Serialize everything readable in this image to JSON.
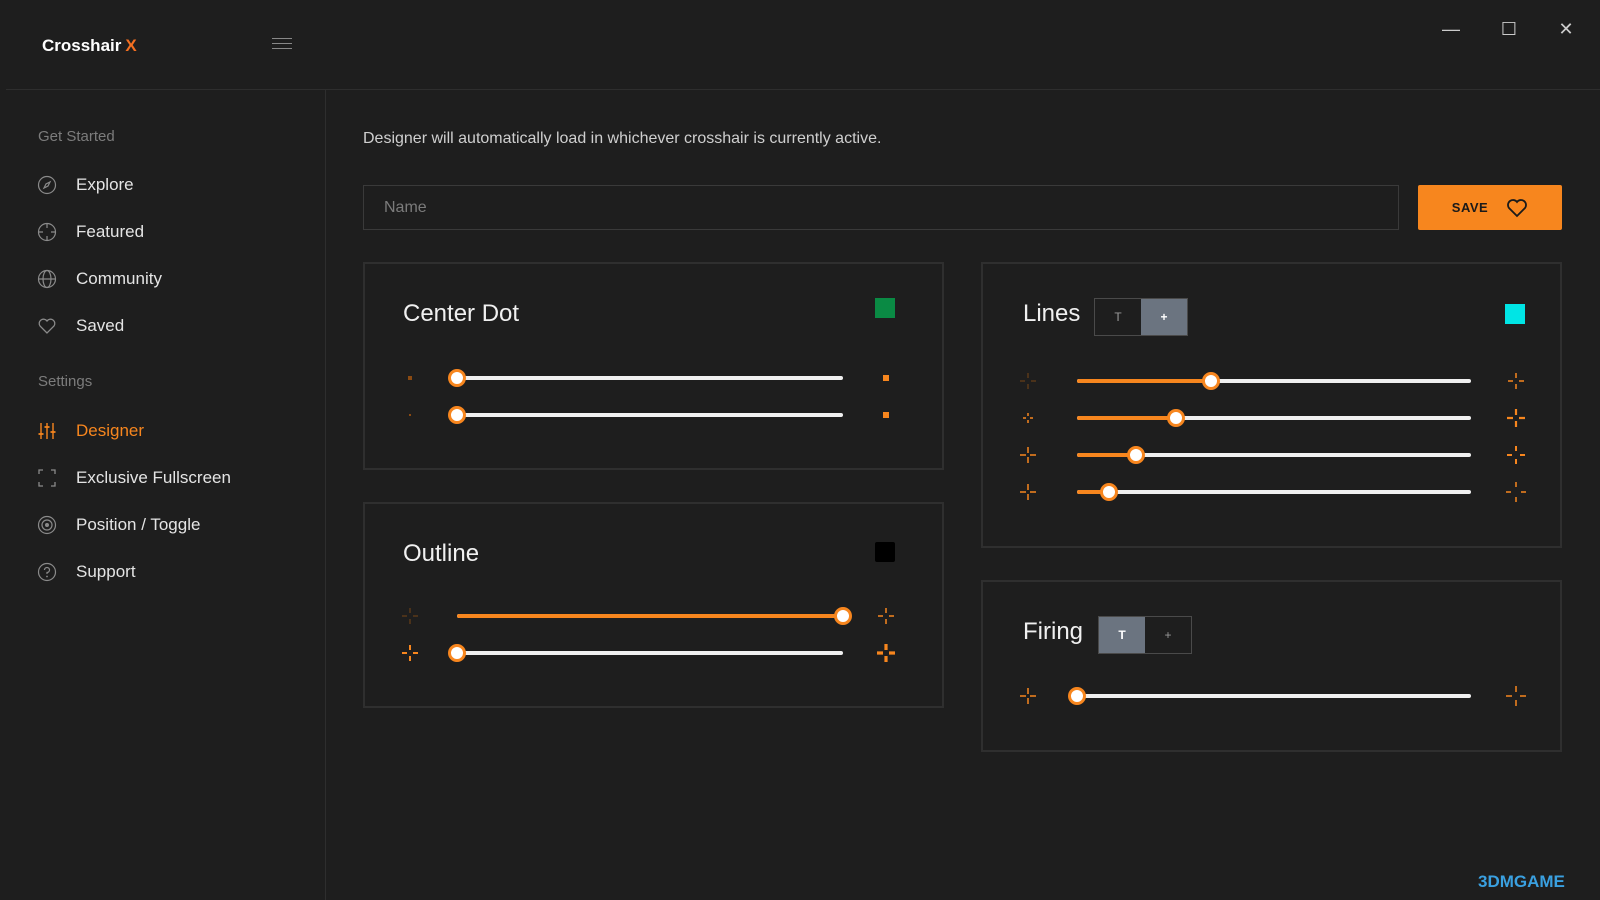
{
  "app": {
    "title_main": "Crosshair",
    "title_accent": "X"
  },
  "window_controls": {
    "minimize": "—",
    "maximize": "☐",
    "close": "✕"
  },
  "sidebar": {
    "sections": [
      {
        "label": "Get Started"
      },
      {
        "label": "Settings"
      }
    ],
    "items": [
      {
        "label": "Explore",
        "icon": "compass-icon"
      },
      {
        "label": "Featured",
        "icon": "crosshair-circle-icon"
      },
      {
        "label": "Community",
        "icon": "globe-icon"
      },
      {
        "label": "Saved",
        "icon": "heart-icon"
      },
      {
        "label": "Designer",
        "icon": "sliders-icon",
        "active": true
      },
      {
        "label": "Exclusive Fullscreen",
        "icon": "fullscreen-icon"
      },
      {
        "label": "Position / Toggle",
        "icon": "target-icon"
      },
      {
        "label": "Support",
        "icon": "help-icon"
      }
    ]
  },
  "main": {
    "intro": "Designer will automatically load in whichever crosshair is currently active.",
    "name_placeholder": "Name",
    "name_value": "",
    "save_label": "SAVE"
  },
  "panels": {
    "center_dot": {
      "title": "Center Dot",
      "color": "#0a8a44",
      "sliders": [
        0.0,
        0.0
      ]
    },
    "outline": {
      "title": "Outline",
      "color": "#000000",
      "sliders": [
        1.0,
        0.0
      ]
    },
    "lines": {
      "title": "Lines",
      "color": "#00e5e5",
      "toggle": [
        "T",
        "+"
      ],
      "toggle_selected": "+",
      "sliders": [
        0.34,
        0.25,
        0.15,
        0.08
      ]
    },
    "firing": {
      "title": "Firing",
      "toggle": [
        "T",
        "+"
      ],
      "toggle_selected": "T",
      "sliders": [
        0.0
      ]
    }
  },
  "colors": {
    "accent": "#f7861e",
    "background": "#1e1e1e",
    "panel_border": "#2f2f2f"
  },
  "watermark": "3DMGAME"
}
